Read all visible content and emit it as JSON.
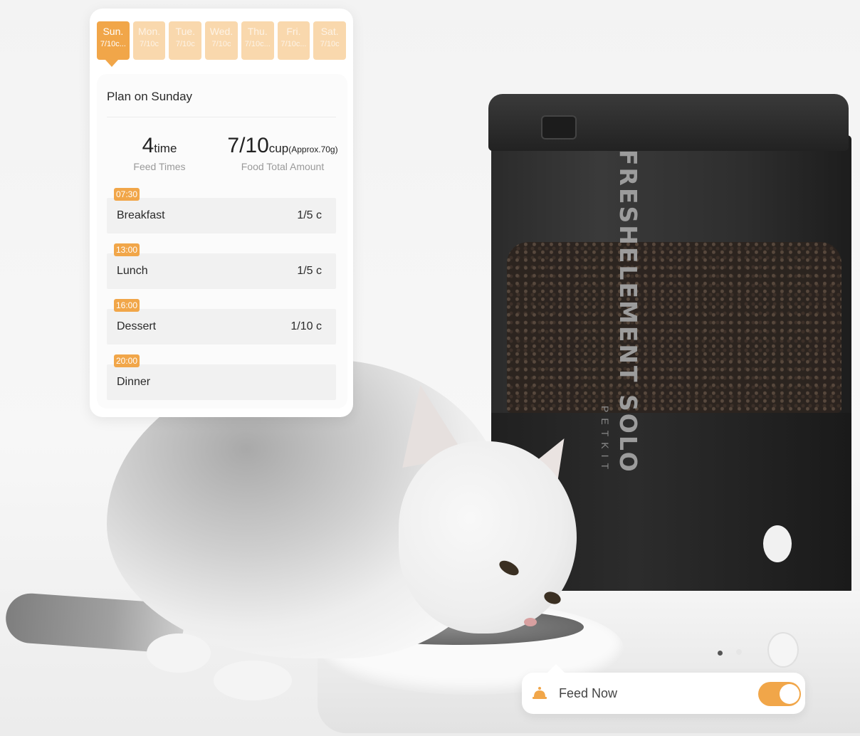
{
  "schedule": {
    "days": [
      {
        "name": "Sun.",
        "value": "7/10c..."
      },
      {
        "name": "Mon.",
        "value": "7/10c"
      },
      {
        "name": "Tue.",
        "value": "7/10c"
      },
      {
        "name": "Wed.",
        "value": "7/10c"
      },
      {
        "name": "Thu.",
        "value": "7/10c..."
      },
      {
        "name": "Fri.",
        "value": "7/10c..."
      },
      {
        "name": "Sat.",
        "value": "7/10c"
      }
    ],
    "selected_day_index": 0,
    "plan_title": "Plan on Sunday",
    "feed_times": {
      "value": "4",
      "unit": "time",
      "label": "Feed Times"
    },
    "food_total": {
      "value": "7/10",
      "unit": "cup",
      "approx": "(Approx.70g)",
      "label": "Food Total Amount"
    },
    "meals": [
      {
        "time": "07:30",
        "name": "Breakfast",
        "amount": "1/5 c"
      },
      {
        "time": "13:00",
        "name": "Lunch",
        "amount": "1/5 c"
      },
      {
        "time": "16:00",
        "name": "Dessert",
        "amount": "1/10 c"
      },
      {
        "time": "20:00",
        "name": "Dinner",
        "amount": ""
      }
    ]
  },
  "device": {
    "brand_name": "FRESHELEMENT SOLO",
    "maker": "PETKIT"
  },
  "feed_now": {
    "label": "Feed Now",
    "enabled": true
  },
  "colors": {
    "accent": "#f1a649",
    "accent_light": "#f9d8ad"
  }
}
